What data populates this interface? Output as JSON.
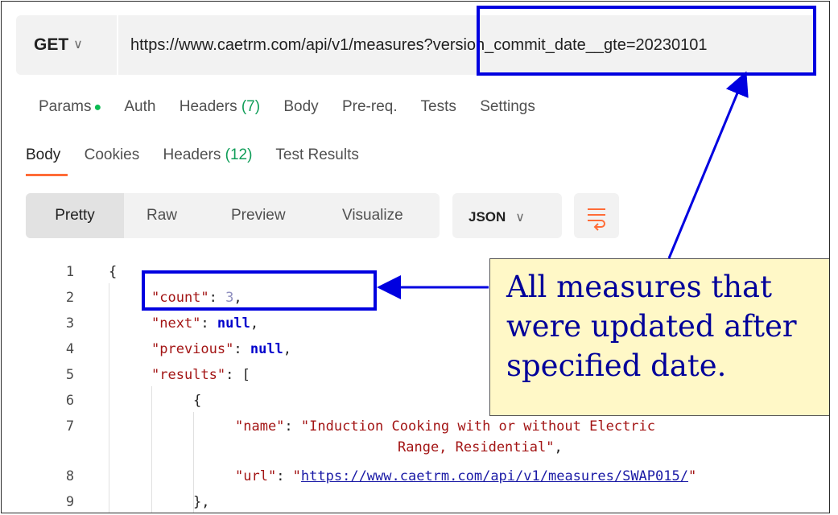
{
  "request": {
    "method": "GET",
    "url": "https://www.caetrm.com/api/v1/measures?version_commit_date__gte=20230101"
  },
  "request_tabs": [
    {
      "label": "Params",
      "suffix": "●"
    },
    {
      "label": "Auth"
    },
    {
      "label": "Headers",
      "count": "(7)"
    },
    {
      "label": "Body"
    },
    {
      "label": "Pre-req."
    },
    {
      "label": "Tests"
    },
    {
      "label": "Settings"
    }
  ],
  "response_tabs": {
    "body": "Body",
    "cookies": "Cookies",
    "headers": "Headers",
    "headers_count": "(12)",
    "test_results": "Test Results"
  },
  "view_modes": {
    "pretty": "Pretty",
    "raw": "Raw",
    "preview": "Preview",
    "visualize": "Visualize"
  },
  "format": {
    "label": "JSON"
  },
  "code": {
    "line_numbers": [
      "1",
      "2",
      "3",
      "4",
      "5",
      "6",
      "7",
      "8",
      "9"
    ],
    "l1": "{",
    "count_key": "\"count\"",
    "count_val": "3",
    "next_key": "\"next\"",
    "next_val": "null",
    "prev_key": "\"previous\"",
    "prev_val": "null",
    "results_key": "\"results\"",
    "results_open": "[",
    "obj_open": "{",
    "name_key": "\"name\"",
    "name_val_1": "\"Induction Cooking with or without Electric",
    "name_val_2": "Range, Residential\"",
    "url_key": "\"url\"",
    "url_q_open": "\"",
    "url_val": "https://www.caetrm.com/api/v1/measures/SWAP015/",
    "url_q_close": "\"",
    "obj_close": "},"
  },
  "annotation": {
    "text": "All measures that\nwere updated after\nspecified date."
  },
  "colors": {
    "annotation_blue": "#0000e0",
    "callout_bg": "#fff8c7",
    "accent_orange": "#ff6c37",
    "status_green": "#0cbb52"
  }
}
